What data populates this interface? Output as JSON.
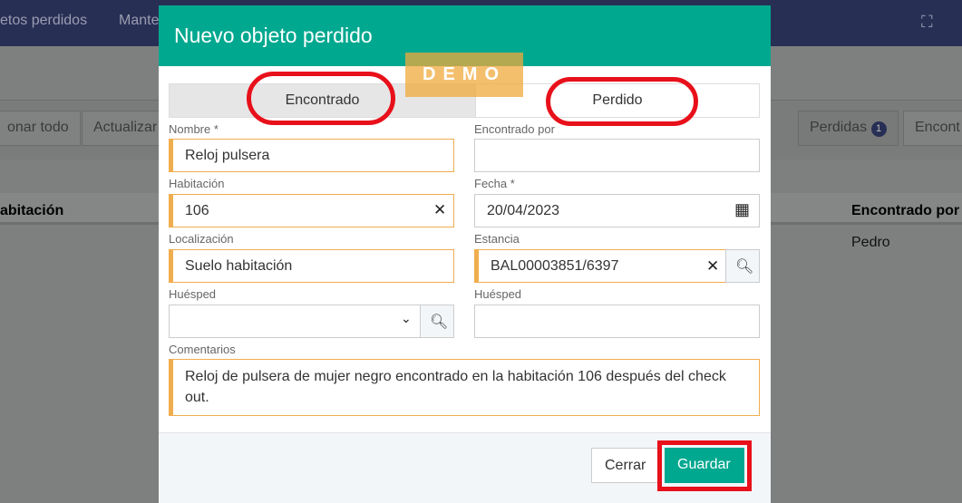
{
  "nav": {
    "items": [
      "etos perdidos",
      "Mante"
    ],
    "fullscreen_icon": "expand-icon"
  },
  "background": {
    "select_all": "onar todo",
    "refresh": "Actualizar",
    "tab_lost": "Perdidas",
    "tab_lost_count": "1",
    "tab_found": "Encont",
    "col_room": "abitación",
    "col_found_by": "Encontrado por",
    "row_found_by": "Pedro"
  },
  "modal": {
    "title": "Nuevo objeto perdido",
    "watermark": "DEMO",
    "tabs": [
      {
        "label": "Encontrado",
        "active": true
      },
      {
        "label": "Perdido",
        "active": false
      }
    ],
    "fields": {
      "nombre": {
        "label": "Nombre *",
        "value": "Reloj pulsera"
      },
      "encontrado_por": {
        "label": "Encontrado por",
        "value": ""
      },
      "habitacion": {
        "label": "Habitación",
        "value": "106"
      },
      "fecha": {
        "label": "Fecha *",
        "value": "20/04/2023"
      },
      "localizacion": {
        "label": "Localización",
        "value": "Suelo habitación"
      },
      "estancia": {
        "label": "Estancia",
        "value": "BAL00003851/6397"
      },
      "huesped_sel": {
        "label": "Huésped",
        "value": ""
      },
      "huesped": {
        "label": "Huésped",
        "value": ""
      },
      "comentarios": {
        "label": "Comentarios",
        "value": "Reloj de pulsera de mujer negro encontrado en la habitación 106 después del check out."
      }
    },
    "buttons": {
      "close": "Cerrar",
      "save": "Guardar"
    },
    "colors": {
      "header": "#00a88f",
      "required": "#f0ad4e",
      "highlight": "#e8101a"
    }
  }
}
